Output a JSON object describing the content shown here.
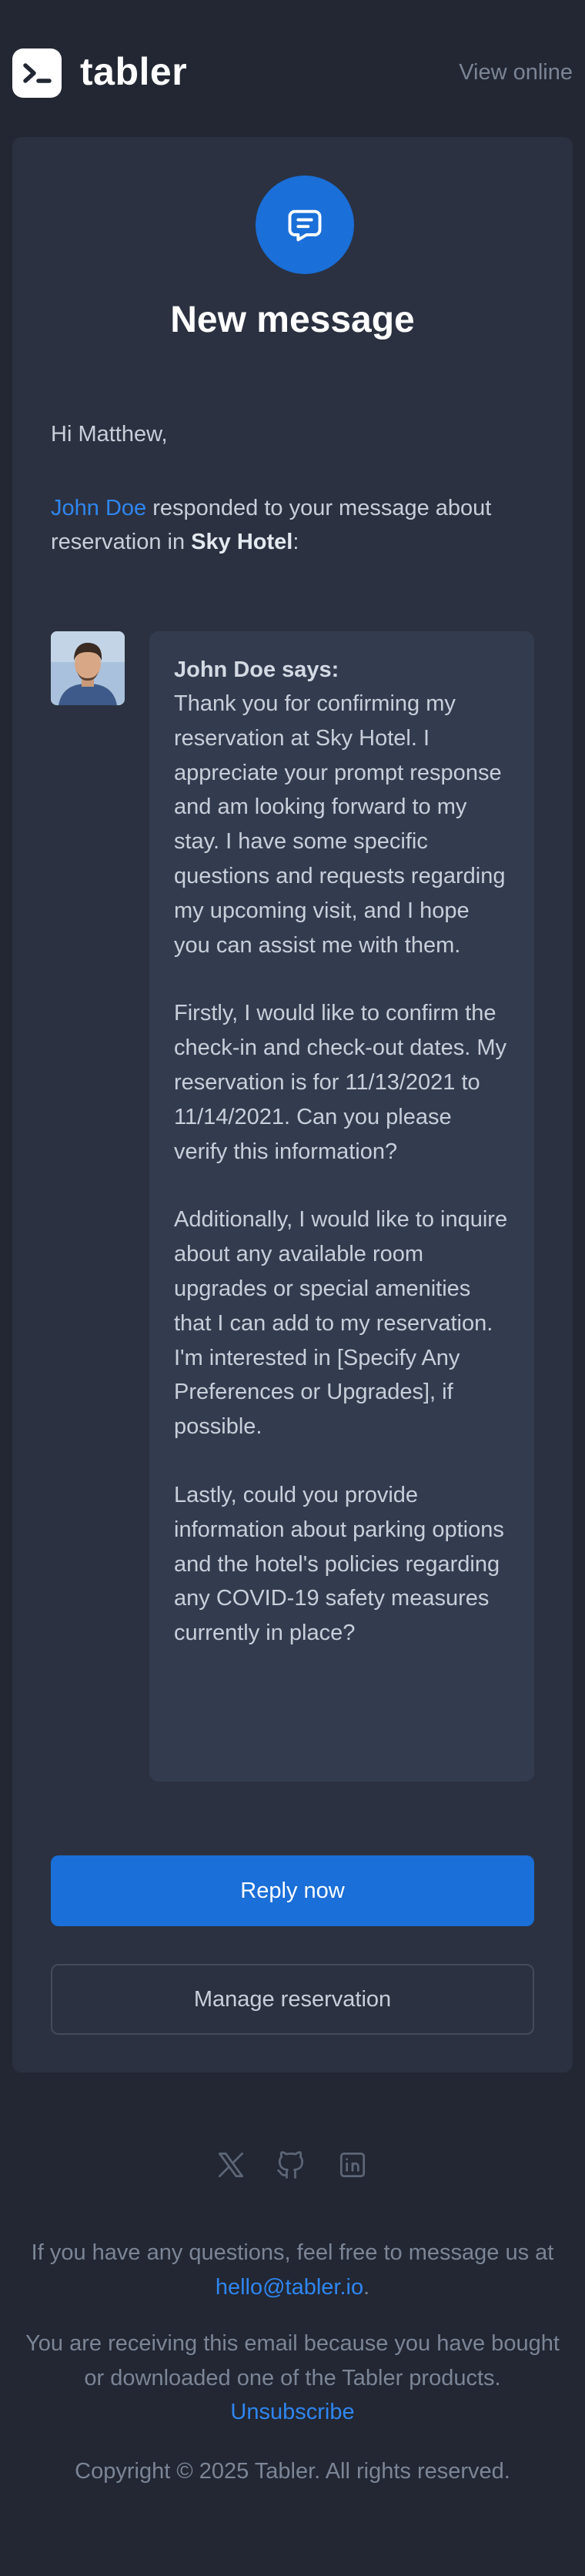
{
  "header": {
    "logo_text": "tabler",
    "view_online": "View online"
  },
  "card": {
    "title": "New message",
    "greeting": "Hi Matthew,",
    "intro": {
      "sender_link": "John Doe",
      "text_1": " responded to your message about reservation in ",
      "hotel": "Sky Hotel",
      "text_2": ":"
    },
    "message": {
      "author": "John Doe says:",
      "paragraphs": [
        "Thank you for confirming my reservation at Sky Hotel. I appreciate your prompt response and am looking forward to my stay. I have some specific questions and requests regarding my upcoming visit, and I hope you can assist me with them.",
        "Firstly, I would like to confirm the check-in and check-out dates. My reservation is for 11/13/2021 to 11/14/2021. Can you please verify this information?",
        "Additionally, I would like to inquire about any available room upgrades or special amenities that I can add to my reservation. I'm interested in [Specify Any Preferences or Upgrades], if possible.",
        "Lastly, could you provide information about parking options and the hotel's policies regarding any COVID-19 safety measures currently in place?"
      ]
    },
    "reply_button": "Reply now",
    "manage_button": "Manage reservation"
  },
  "social": {
    "icons": [
      "x-twitter-icon",
      "github-icon",
      "linkedin-icon"
    ]
  },
  "footer": {
    "questions_text": "If you have any questions, feel free to message us at ",
    "email": "hello@tabler.io",
    "questions_end": ".",
    "receiving_text": "You are receiving this email because you have bought or downloaded one of the Tabler products.",
    "unsubscribe": "Unsubscribe",
    "copyright": "Copyright © 2025 Tabler. All rights reserved."
  },
  "colors": {
    "background": "#222733",
    "card": "#2b3140",
    "bubble": "#333c4f",
    "accent": "#1a6fd8",
    "link": "#2f86f0",
    "muted": "#7b8596"
  }
}
